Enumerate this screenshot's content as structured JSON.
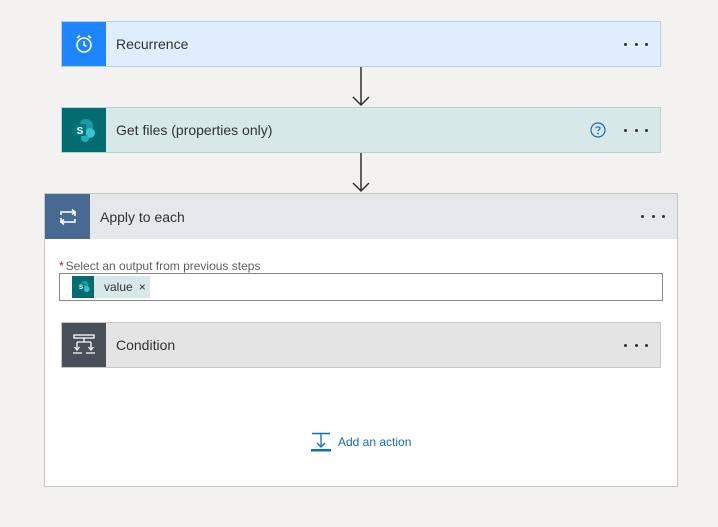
{
  "recurrence": {
    "title": "Recurrence",
    "icon": "alarm-clock-icon",
    "color": "#1f85ff"
  },
  "get_files": {
    "title": "Get files (properties only)",
    "icon": "sharepoint-icon",
    "color": "#036c70"
  },
  "apply_to_each": {
    "title": "Apply to each",
    "icon": "loop-icon",
    "color": "#486991",
    "field_required_mark": "*",
    "field_label": "Select an output from previous steps",
    "token": {
      "label": "value",
      "remove": "×"
    }
  },
  "condition": {
    "title": "Condition",
    "icon": "condition-icon",
    "color": "#484f58"
  },
  "add_action": {
    "label": "Add an action"
  }
}
